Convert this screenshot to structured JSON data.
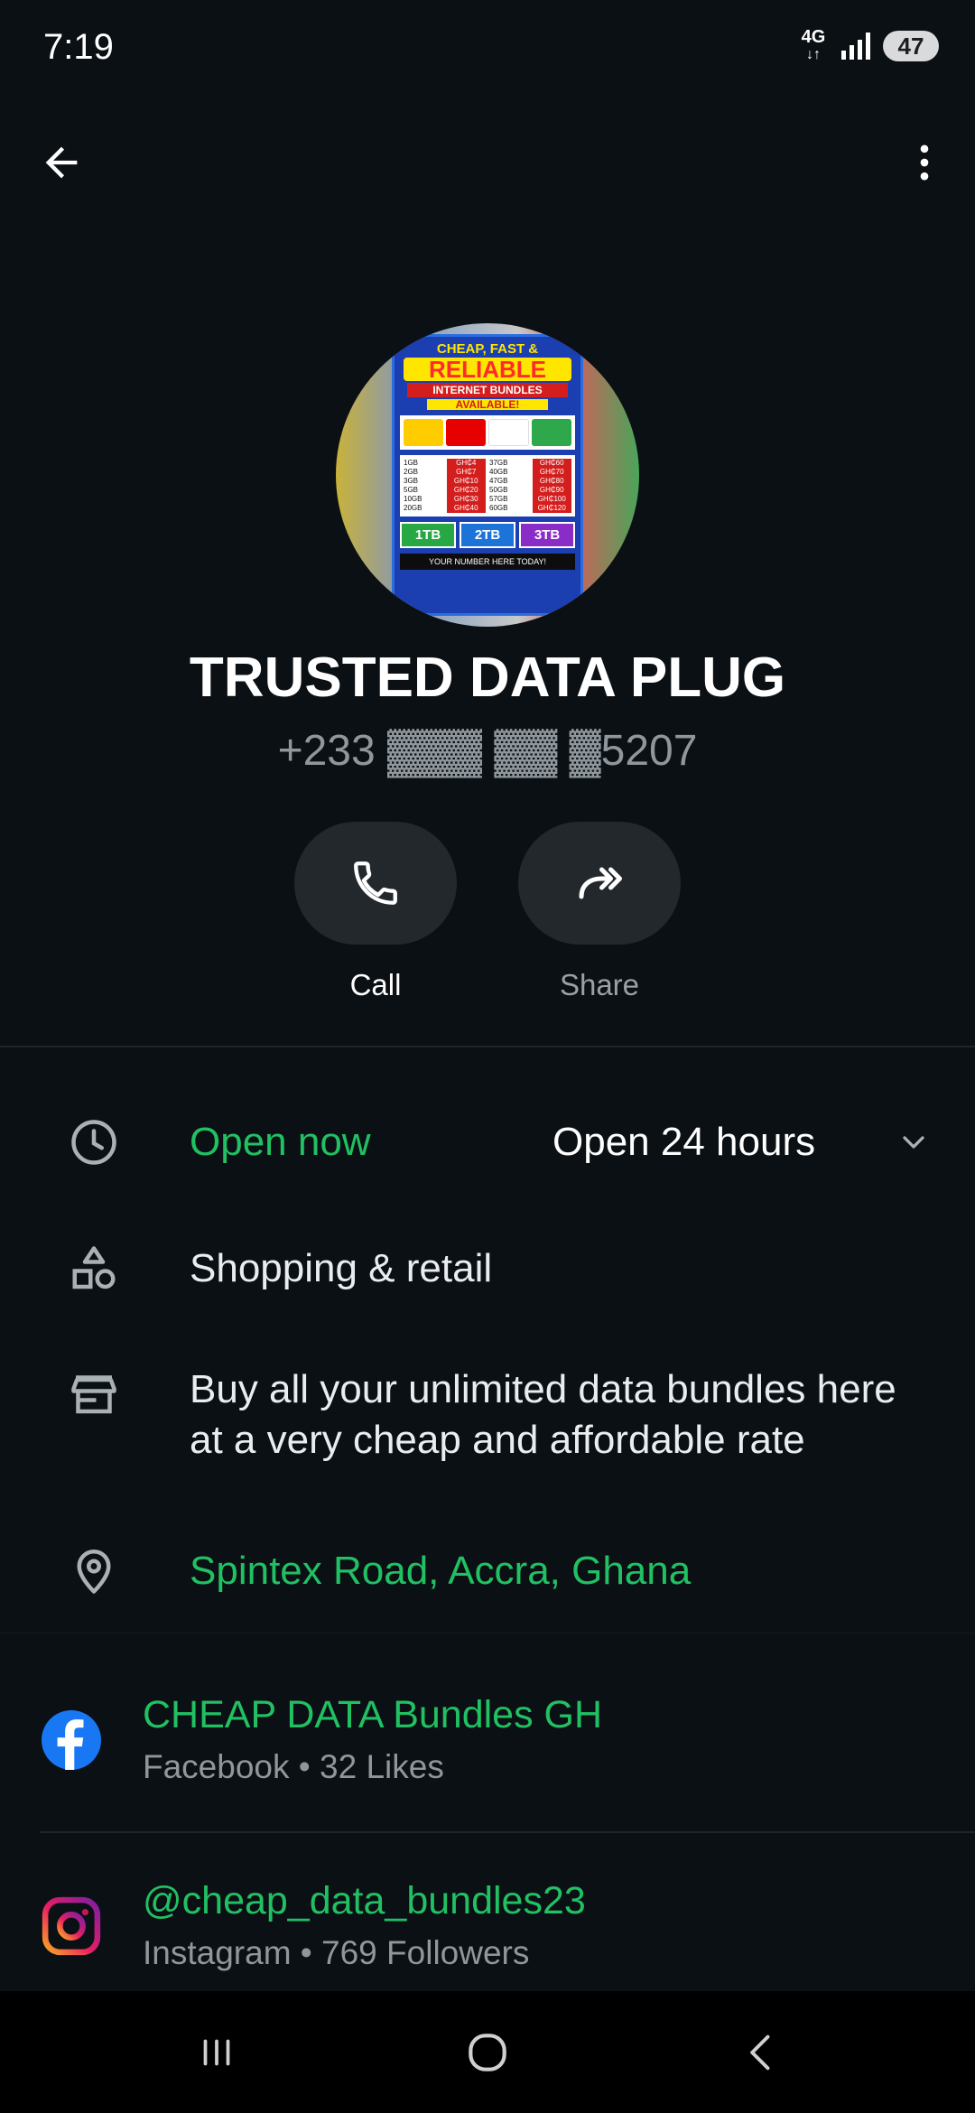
{
  "status_bar": {
    "time": "7:19",
    "network_type": "4G",
    "battery": "47"
  },
  "contact": {
    "name": "TRUSTED DATA PLUG",
    "phone": "+233 ▓▓▓ ▓▓ ▓5207",
    "avatar_alt": "business-profile-photo"
  },
  "poster": {
    "line1": "CHEAP, FAST &",
    "line2": "RELIABLE",
    "line3": "INTERNET BUNDLES",
    "line4": "AVAILABLE!",
    "rows": [
      [
        "1GB",
        "GH₵4",
        "37GB",
        "GH₵60"
      ],
      [
        "2GB",
        "GH₵7",
        "40GB",
        "GH₵70"
      ],
      [
        "3GB",
        "GH₵10",
        "47GB",
        "GH₵80"
      ],
      [
        "5GB",
        "GH₵20",
        "50GB",
        "GH₵90"
      ],
      [
        "10GB",
        "GH₵30",
        "57GB",
        "GH₵100"
      ],
      [
        "20GB",
        "GH₵40",
        "60GB",
        "GH₵120"
      ]
    ],
    "bulk": [
      "1TB",
      "2TB",
      "3TB"
    ],
    "footer": "YOUR NUMBER HERE  TODAY!"
  },
  "actions": {
    "call_label": "Call",
    "share_label": "Share"
  },
  "business_info": {
    "status": "Open now",
    "hours": "Open 24 hours",
    "category": "Shopping & retail",
    "description_line1": "Buy all your unlimited data bundles here",
    "description_line2": "at a very cheap and affordable rate",
    "address": "Spintex Road, Accra, Ghana"
  },
  "social": [
    {
      "platform": "Facebook",
      "title": "CHEAP DATA Bundles GH",
      "subtitle": "Facebook • 32 Likes",
      "icon": "facebook-icon"
    },
    {
      "platform": "Instagram",
      "title": "@cheap_data_bundles23",
      "subtitle": "Instagram • 769 Followers",
      "icon": "instagram-icon"
    }
  ],
  "colors": {
    "background": "#0b1014",
    "accent_green": "#21c063",
    "secondary_text": "#8f979c",
    "button_surface": "#22282c"
  }
}
